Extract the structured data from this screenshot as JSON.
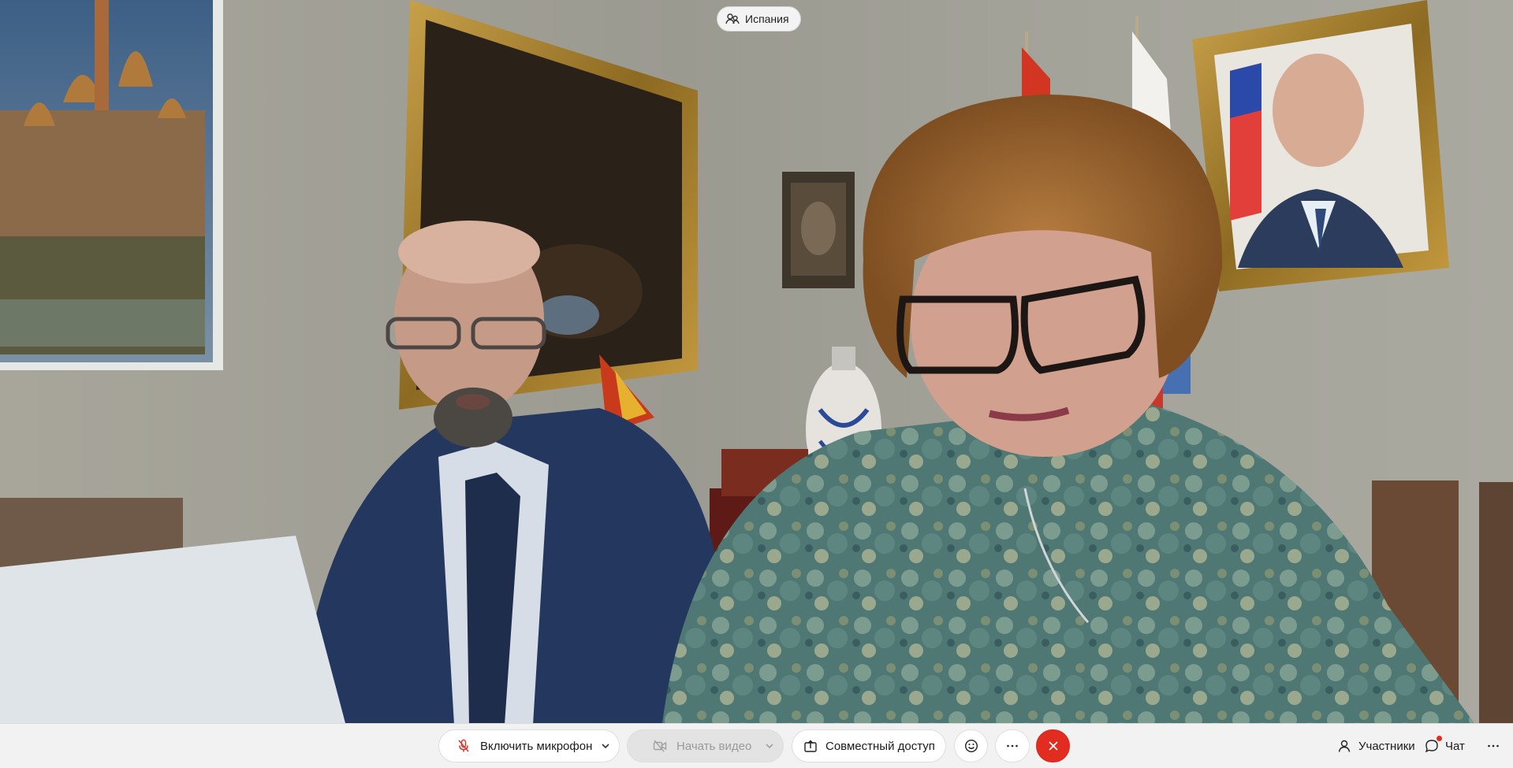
{
  "meeting": {
    "room_name": "Испания",
    "room_icon": "people-group-icon"
  },
  "toolbar": {
    "mic_label": "Включить микрофон",
    "mic_icon": "microphone-muted-icon",
    "video_label": "Начать видео",
    "video_icon": "video-camera-off-icon",
    "video_enabled": false,
    "share_label": "Совместный доступ",
    "share_icon": "share-screen-icon",
    "reactions_icon": "smiley-icon",
    "more_icon": "more-dots-icon",
    "leave_icon": "close-icon",
    "participants_label": "Участники",
    "participants_icon": "person-icon",
    "chat_label": "Чат",
    "chat_icon": "chat-bubble-icon",
    "chat_unread": true,
    "overflow_icon": "more-dots-icon"
  },
  "colors": {
    "toolbar_bg": "#f2f2f2",
    "leave_red": "#e22c1f",
    "mic_muted_red": "#d9352a",
    "unread_dot": "#e22c1f"
  }
}
